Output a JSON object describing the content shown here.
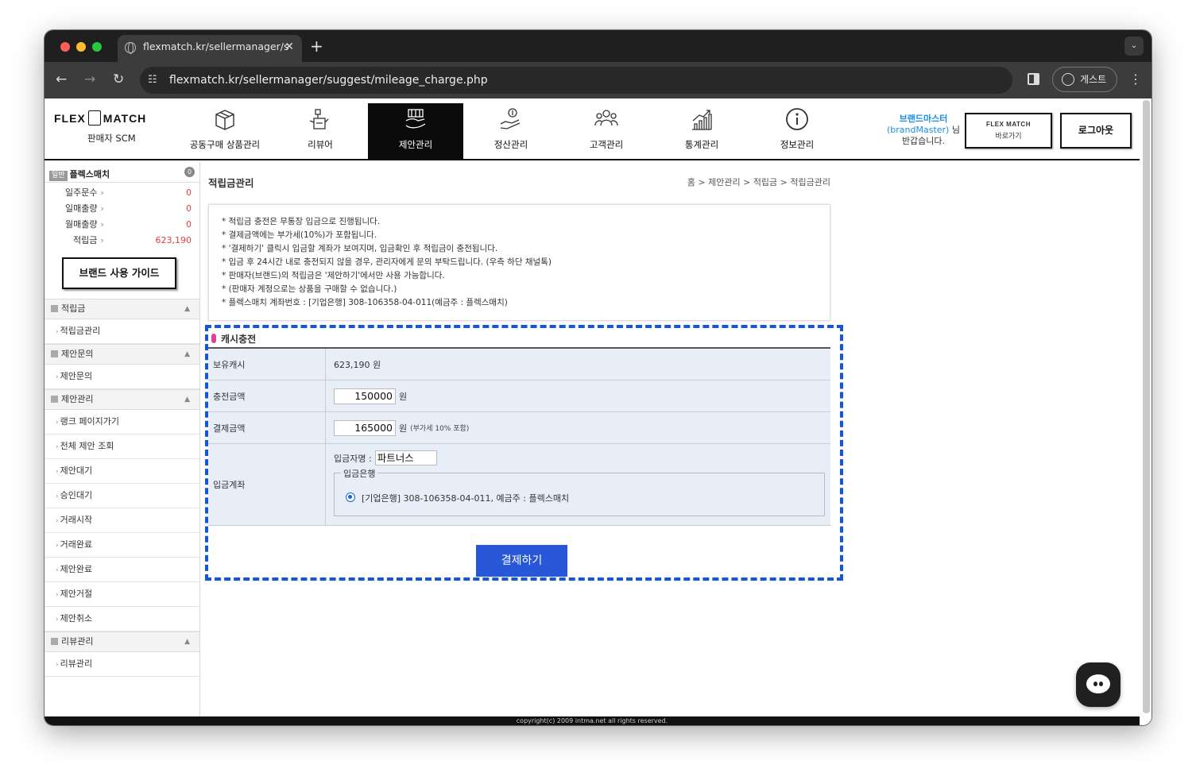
{
  "browser": {
    "tab_title": "flexmatch.kr/sellermanager/s",
    "url": "flexmatch.kr/sellermanager/suggest/mileage_charge.php",
    "guest_label": "게스트"
  },
  "header": {
    "logo_left": "FLEX",
    "logo_right": "MATCH",
    "logo_sub": "판매자 SCM",
    "nav": [
      {
        "label": "공동구매 상품관리",
        "icon": "box-icon"
      },
      {
        "label": "리뷰어",
        "icon": "reviewer-icon"
      },
      {
        "label": "제안관리",
        "icon": "proposal-icon",
        "active": true
      },
      {
        "label": "정산관리",
        "icon": "settlement-icon"
      },
      {
        "label": "고객관리",
        "icon": "customers-icon"
      },
      {
        "label": "통계관리",
        "icon": "stats-icon"
      },
      {
        "label": "정보관리",
        "icon": "info-icon"
      }
    ],
    "greeting_name": "브랜드마스터",
    "greeting_id": "(brandMaster)",
    "greeting_suffix": "님",
    "greeting_line2": "반갑습니다.",
    "shortcut_logo": "FLEX MATCH",
    "shortcut_label": "바로가기",
    "logout_label": "로그아웃"
  },
  "sidebar": {
    "badge": "일반",
    "username": "플렉스매치",
    "count": "0",
    "stats": [
      {
        "label": "일주문수",
        "value": "0"
      },
      {
        "label": "일매출량",
        "value": "0"
      },
      {
        "label": "월매출량",
        "value": "0"
      },
      {
        "label": "적립금",
        "value": "623,190"
      }
    ],
    "guide_label": "브랜드 사용 가이드",
    "sections": [
      {
        "title": "적립금",
        "items": [
          "적립금관리"
        ]
      },
      {
        "title": "제안문의",
        "items": [
          "제안문의"
        ]
      },
      {
        "title": "제안관리",
        "items": [
          "랭크 페이지가기",
          "전체 제안 조회",
          "제안대기",
          "승인대기",
          "거래시작",
          "거래완료",
          "제안완료",
          "제안거절",
          "제안취소"
        ]
      },
      {
        "title": "리뷰관리",
        "items": [
          "리뷰관리"
        ]
      }
    ]
  },
  "main": {
    "title": "적립금관리",
    "breadcrumb": "홈 > 제안관리 > 적립금 > 적립금관리",
    "notices": [
      "* 적립금 충전은 무통장 입금으로 진행됩니다.",
      "* 결제금액에는 부가세(10%)가 포함됩니다.",
      "* '결제하기' 클릭시 입금할 계좌가 보여지며, 입금확인 후 적립금이 충전됩니다.",
      "* 입금 후 24시간 내로 충전되지 않을 경우, 관리자에게 문의 부탁드립니다. (우측 하단 채널톡)",
      "* 판매자(브랜드)의 적립금은 '제안하기'에서만 사용 가능합니다.",
      "* (판매자 계정으로는 상품을 구매할 수 없습니다.)",
      "* 플렉스매치 계좌번호 : [기업은행] 308-106358-04-011(예금주 : 플렉스매치)"
    ],
    "cash_title": "캐시충전",
    "held_label": "보유캐시",
    "held_value": "623,190 원",
    "charge_label": "충전금액",
    "charge_value": "150000",
    "won": "원",
    "pay_label": "결제금액",
    "pay_value": "165000",
    "vat_note": "(부가세 10% 포함)",
    "account_label": "입금계좌",
    "depositor_label": "입금자명 :",
    "depositor_value": "파트너스",
    "bank_legend": "입금은행",
    "bank_option": "[기업은행] 308-106358-04-011, 예금주 : 플렉스매치",
    "pay_button": "결제하기"
  },
  "footer": "copyright(c) 2009 intma.net all rights reserved.",
  "colors": {
    "accent": "#2857d8",
    "dashed_border": "#1456d8",
    "link": "#1a8ee3",
    "stat_value": "#e04040"
  }
}
